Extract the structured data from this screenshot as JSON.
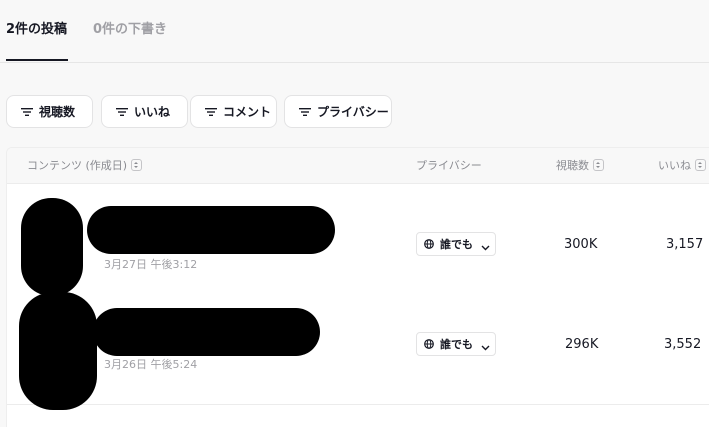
{
  "tabs": [
    {
      "label": "2件の投稿",
      "active": true
    },
    {
      "label": "0件の下書き",
      "active": false
    }
  ],
  "filters": [
    {
      "label": "視聴数",
      "icon": "filter-icon"
    },
    {
      "label": "いいね",
      "icon": "filter-icon"
    },
    {
      "label": "コメント",
      "icon": "filter-icon"
    },
    {
      "label": "プライバシー",
      "icon": "filter-icon"
    }
  ],
  "table": {
    "headers": {
      "content": "コンテンツ (作成日)",
      "privacy": "プライバシー",
      "views": "視聴数",
      "likes": "いいね"
    },
    "rows": [
      {
        "date": "3月27日 午後3:12",
        "privacy": "誰でも",
        "views": "300K",
        "likes": "3,157"
      },
      {
        "date": "3月26日 午後5:24",
        "privacy": "誰でも",
        "views": "296K",
        "likes": "3,552"
      }
    ]
  },
  "colors": {
    "text": "#161823",
    "muted": "#a0a0a5",
    "border": "#e3e3e4",
    "background": "#f8f8f8"
  }
}
